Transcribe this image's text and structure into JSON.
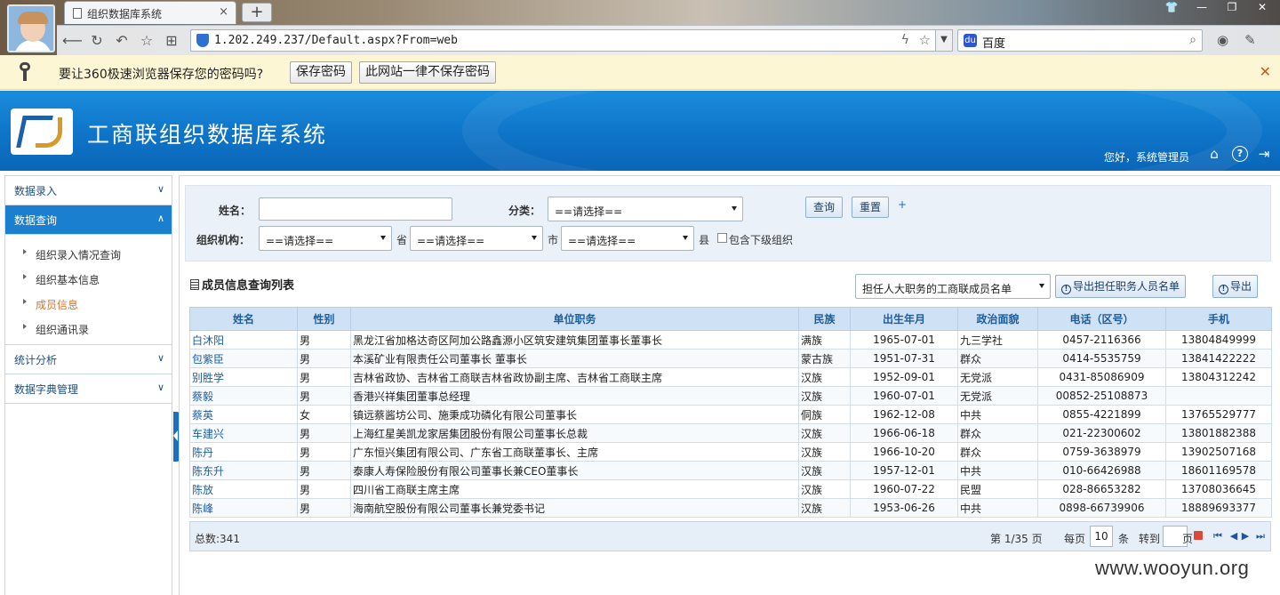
{
  "browser": {
    "tab_title": "组织数据库系统",
    "tab_close": "×",
    "new_tab": "+",
    "url": "1.202.249.237/Default.aspx?From=web",
    "search_value": "百度",
    "window_controls": [
      "👕",
      "—",
      "❐",
      "✕"
    ]
  },
  "password_bar": {
    "message": "要让360极速浏览器保存您的密码吗?",
    "save_label": "保存密码",
    "never_label": "此网站一律不保存密码",
    "close": "✕"
  },
  "header": {
    "title": "工商联组织数据库系统",
    "greeting": "您好，系统管理员"
  },
  "sidebar": {
    "groups": [
      {
        "label": "数据录入",
        "chevron": "∨"
      },
      {
        "label": "数据查询",
        "chevron": "∧"
      },
      {
        "label": "统计分析",
        "chevron": "∨"
      },
      {
        "label": "数据字典管理",
        "chevron": "∨"
      }
    ],
    "subitems": [
      "组织录入情况查询",
      "组织基本信息",
      "成员信息",
      "组织通讯录"
    ]
  },
  "query": {
    "name_label": "姓名：",
    "name_value": "",
    "category_label": "分类：",
    "category_value": "==请选择==",
    "org_label": "组织机构：",
    "province_value": "==请选择==",
    "province_suffix": "省",
    "city_value": "==请选择==",
    "city_suffix": "市",
    "county_value": "==请选择==",
    "county_suffix": "县",
    "include_sub_label": "包含下级组织",
    "search_btn": "查询",
    "reset_btn": "重置",
    "plus": "+"
  },
  "list": {
    "title": "成员信息查询列表",
    "export_select": "担任人大职务的工商联成员名单",
    "export_positions_btn": "导出担任职务人员名单",
    "export_btn": "导出",
    "columns": [
      "姓名",
      "性别",
      "单位职务",
      "民族",
      "出生年月",
      "政治面貌",
      "电话（区号）",
      "手机"
    ],
    "rows": [
      [
        "白沐阳",
        "男",
        "黑龙江省加格达奇区阿加公路鑫源小区筑安建筑集团董事长董事长",
        "满族",
        "1965-07-01",
        "九三学社",
        "0457-2116366",
        "13804849999"
      ],
      [
        "包紫臣",
        "男",
        "本溪矿业有限责任公司董事长 董事长",
        "蒙古族",
        "1951-07-31",
        "群众",
        "0414-5535759",
        "13841422222"
      ],
      [
        "别胜学",
        "男",
        "吉林省政协、吉林省工商联吉林省政协副主席、吉林省工商联主席",
        "汉族",
        "1952-09-01",
        "无党派",
        "0431-85086909",
        "13804312242"
      ],
      [
        "蔡毅",
        "男",
        "香港兴祥集团董事总经理",
        "汉族",
        "1960-07-01",
        "无党派",
        "00852-25108873",
        ""
      ],
      [
        "蔡英",
        "女",
        "镇远蔡酱坊公司、施秉成功磷化有限公司董事长",
        "侗族",
        "1962-12-08",
        "中共",
        "0855-4221899",
        "13765529777"
      ],
      [
        "车建兴",
        "男",
        "上海红星美凯龙家居集团股份有限公司董事长总裁",
        "汉族",
        "1966-06-18",
        "群众",
        "021-22300602",
        "13801882388"
      ],
      [
        "陈丹",
        "男",
        "广东恒兴集团有限公司、广东省工商联董事长、主席",
        "汉族",
        "1966-10-20",
        "群众",
        "0759-3638979",
        "13902507168"
      ],
      [
        "陈东升",
        "男",
        "泰康人寿保险股份有限公司董事长兼CEO董事长",
        "汉族",
        "1957-12-01",
        "中共",
        "010-66426988",
        "18601169578"
      ],
      [
        "陈放",
        "男",
        "四川省工商联主席主席",
        "汉族",
        "1960-07-22",
        "民盟",
        "028-86653282",
        "13708036645"
      ],
      [
        "陈峰",
        "男",
        "海南航空股份有限公司董事长兼党委书记",
        "汉族",
        "1953-06-26",
        "中共",
        "0898-66739906",
        "18889693377"
      ]
    ]
  },
  "pager": {
    "total": "总数:341",
    "page_info": "第 1/35 页",
    "per_page_label": "每页",
    "per_page_value": "10",
    "per_page_unit": "条",
    "goto_label": "转到",
    "goto_unit": "页",
    "nav": [
      "⏮",
      "◀",
      "▶",
      "⏭"
    ]
  },
  "watermark": "www.wooyun.org",
  "colors": {
    "accent": "#1b7fd0",
    "header_bg": "#0e74c8",
    "link": "#1a5fa6",
    "current_item": "#d8732a"
  }
}
